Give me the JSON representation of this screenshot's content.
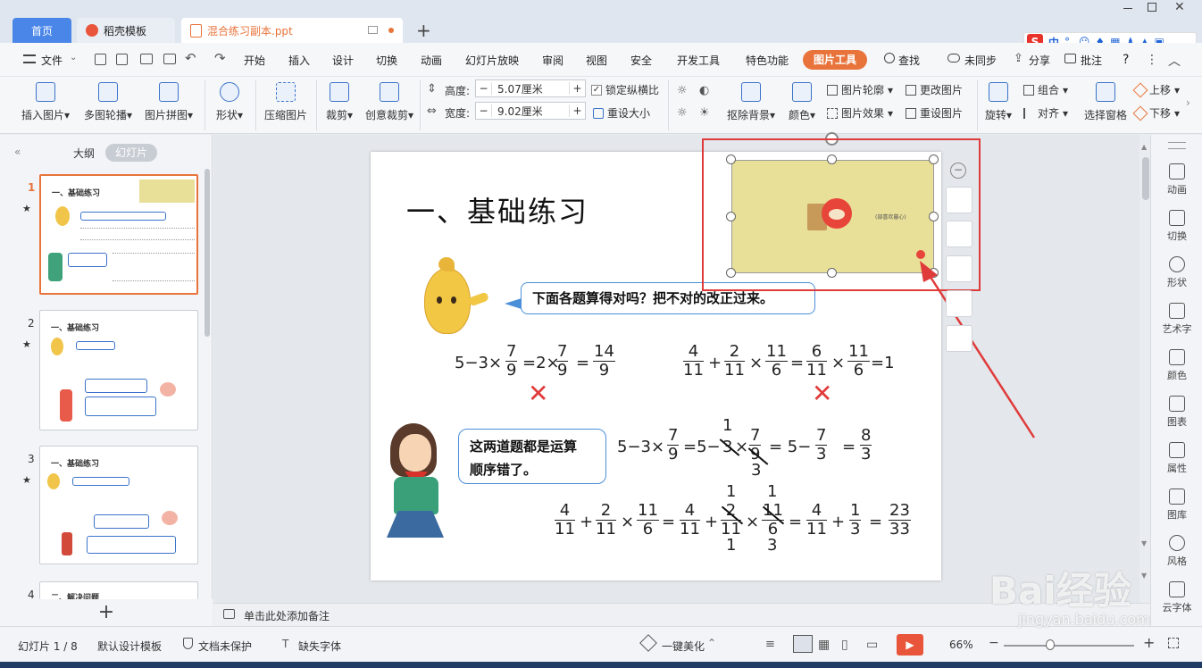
{
  "tabs": {
    "home": "首页",
    "template": "稻壳模板",
    "doc": "混合练习副本.ppt",
    "new_tab": "+"
  },
  "ime": {
    "logo": "S",
    "lang": "中"
  },
  "menu": {
    "file": "文件",
    "items": [
      "开始",
      "插入",
      "设计",
      "切换",
      "动画",
      "幻灯片放映",
      "审阅",
      "视图",
      "安全",
      "开发工具",
      "特色功能"
    ],
    "active": "图片工具",
    "search": "查找",
    "sync": "未同步",
    "share": "分享",
    "comment": "批注",
    "help": "?"
  },
  "ribbon": {
    "insert_pic": "插入图片",
    "multi_outline": "多图轮播",
    "pic_collage": "图片拼图",
    "shape": "形状",
    "compress": "压缩图片",
    "crop": "裁剪",
    "creative_crop": "创意裁剪",
    "height_label": "高度:",
    "height_value": "5.07厘米",
    "width_label": "宽度:",
    "width_value": "9.02厘米",
    "lock_ratio": "锁定纵横比",
    "reset_size": "重设大小",
    "remove_bg": "抠除背景",
    "color": "颜色",
    "pic_outline": "图片轮廓",
    "pic_effect": "图片效果",
    "change_pic": "更改图片",
    "reset_pic": "重设图片",
    "rotate": "旋转",
    "group": "组合",
    "align": "对齐",
    "select_pane": "选择窗格",
    "move_up": "上移",
    "move_down": "下移"
  },
  "left_panel": {
    "outline_tab": "大纲",
    "slides_tab": "幻灯片",
    "thumbs": [
      {
        "num": "1",
        "title": "一、基础练习"
      },
      {
        "num": "2",
        "title": "一、基础练习"
      },
      {
        "num": "3",
        "title": "一、基础练习"
      },
      {
        "num": "4",
        "title": "二、解决问题"
      }
    ],
    "add": "+"
  },
  "slide": {
    "title": "一、基础练习",
    "bubble1": "下面各题算得对吗？把不对的改正过来。",
    "bubble2_line1": "这两道题都是运算",
    "bubble2_line2": "顺序错了。",
    "pic_caption": "(部喜欢暮心)",
    "eq1": {
      "a": "5−3×",
      "f1n": "7",
      "f1d": "9",
      "b": "=2×",
      "f2n": "7",
      "f2d": "9",
      "c": "=",
      "f3n": "14",
      "f3d": "9"
    },
    "eq2": {
      "f1n": "4",
      "f1d": "11",
      "op1": "+",
      "f2n": "2",
      "f2d": "11",
      "op2": "×",
      "f3n": "11",
      "f3d": "6",
      "eq": "=",
      "f4n": "6",
      "f4d": "11",
      "op3": "×",
      "f5n": "11",
      "f5d": "6",
      "res": "=1"
    },
    "eq3": {
      "a": "5−3×",
      "f1n": "7",
      "f1d": "9",
      "b": "=5−",
      "s1": "3",
      "s1top": "1",
      "s2": "×",
      "f2n": "7",
      "f2d": "9",
      "f2bot": "3",
      "c": "= 5−",
      "f3n": "7",
      "f3d": "3",
      "d": "=",
      "f4n": "8",
      "f4d": "3"
    },
    "eq4": {
      "f1n": "4",
      "f1d": "11",
      "op1": "+",
      "f2n": "2",
      "f2d": "11",
      "op2": "×",
      "f3n": "11",
      "f3d": "6",
      "eq": "=",
      "f4n": "4",
      "f4d": "11",
      "op3": "+",
      "f5n": "2",
      "f5d": "11",
      "f5top": "1",
      "f5bot": "1",
      "op4": "×",
      "f6n": "11",
      "f6d": "6",
      "f6top": "1",
      "f6bot": "3",
      "eq2": "=",
      "f7n": "4",
      "f7d": "11",
      "op5": "+",
      "f8n": "1",
      "f8d": "3",
      "eq3": "=",
      "f9n": "23",
      "f9d": "33"
    }
  },
  "right_panel": [
    "动画",
    "切换",
    "形状",
    "艺术字",
    "颜色",
    "图表",
    "属性",
    "图库",
    "风格",
    "云字体"
  ],
  "notes": "单击此处添加备注",
  "status": {
    "slide_count": "幻灯片 1 / 8",
    "template": "默认设计模板",
    "protect": "文档未保护",
    "font_missing": "缺失字体",
    "beautify": "一键美化",
    "zoom": "66%"
  },
  "watermark": {
    "text": "Bai经验",
    "url": "jingyan.baidu.com"
  },
  "colors": {
    "accent": "#e8743b",
    "selection": "#e03b3b",
    "tab_active": "#4a86e8",
    "pic_bg": "#e8df98"
  }
}
